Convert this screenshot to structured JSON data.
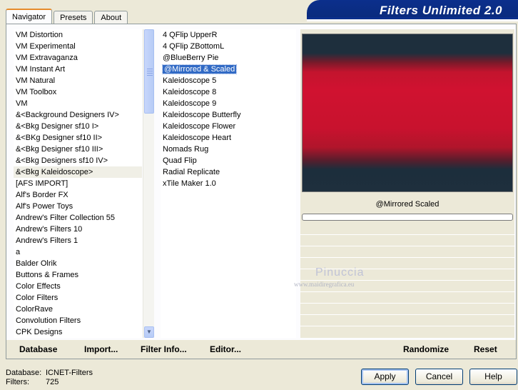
{
  "banner": {
    "title": "Filters Unlimited 2.0"
  },
  "tabs": [
    {
      "label": "Navigator",
      "active": true
    },
    {
      "label": "Presets",
      "active": false
    },
    {
      "label": "About",
      "active": false
    }
  ],
  "categories": [
    "VM Distortion",
    "VM Experimental",
    "VM Extravaganza",
    "VM Instant Art",
    "VM Natural",
    "VM Toolbox",
    "VM",
    "&<Background Designers IV>",
    "&<Bkg Designer sf10 I>",
    "&<BKg Designer sf10 II>",
    "&<Bkg Designer sf10 III>",
    "&<Bkg Designers sf10 IV>",
    "&<Bkg Kaleidoscope>",
    "[AFS IMPORT]",
    "Alf's Border FX",
    "Alf's Power Toys",
    "Andrew's Filter Collection 55",
    "Andrew's Filters 10",
    "Andrew's Filters 1",
    "a",
    "Balder Olrik",
    "Buttons & Frames",
    "Color Effects",
    "Color Filters",
    "ColorRave",
    "Convolution Filters",
    "CPK Designs"
  ],
  "selected_category_index": 12,
  "filters": [
    "4 QFlip UpperR",
    "4 QFlip ZBottomL",
    "@BlueBerry Pie",
    "@Mirrored & Scaled",
    "Kaleidoscope 5",
    "Kaleidoscope 8",
    "Kaleidoscope 9",
    "Kaleidoscope Butterfly",
    "Kaleidoscope Flower",
    "Kaleidoscope Heart",
    "Nomads Rug",
    "Quad Flip",
    "Radial Replicate",
    "xTile Maker 1.0"
  ],
  "selected_filter_index": 3,
  "preview": {
    "filter_name": "@Mirrored  Scaled"
  },
  "watermark": {
    "name": "Pinuccia",
    "url": "www.maidiregrafica.eu"
  },
  "toolbar": {
    "database": "Database",
    "import": "Import...",
    "filter_info": "Filter Info...",
    "editor": "Editor...",
    "randomize": "Randomize",
    "reset": "Reset"
  },
  "status": {
    "database_label": "Database:",
    "database_value": "ICNET-Filters",
    "filters_label": "Filters:",
    "filters_value": "725"
  },
  "buttons": {
    "apply": "Apply",
    "cancel": "Cancel",
    "help": "Help"
  }
}
